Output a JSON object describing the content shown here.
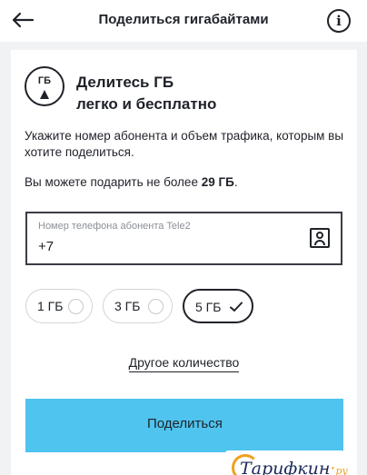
{
  "header": {
    "title": "Поделиться гигабайтами",
    "back_icon": "arrow-left-icon",
    "info_icon": "info-icon",
    "info_glyph": "i"
  },
  "intro": {
    "badge_text": "ГБ",
    "heading_line1": "Делитесь ГБ",
    "heading_line2": "легко и бесплатно",
    "description": "Укажите номер абонента и объем трафика, которым вы хотите поделиться.",
    "limit_prefix": "Вы можете подарить не более ",
    "limit_value": "29 ГБ",
    "limit_suffix": "."
  },
  "phone_field": {
    "label": "Номер телефона абонента Tele2",
    "value": "+7",
    "contact_icon": "contact-book-icon"
  },
  "amount_options": [
    {
      "label": "1 ГБ",
      "selected": false
    },
    {
      "label": "3 ГБ",
      "selected": false
    },
    {
      "label": "5 ГБ",
      "selected": true
    }
  ],
  "other_amount_link": "Другое количество",
  "share_button": {
    "label": "Поделиться",
    "color": "#4fc4ef"
  },
  "watermark": {
    "main": "Тарифкин",
    "dot": "·",
    "suffix": "ру"
  }
}
